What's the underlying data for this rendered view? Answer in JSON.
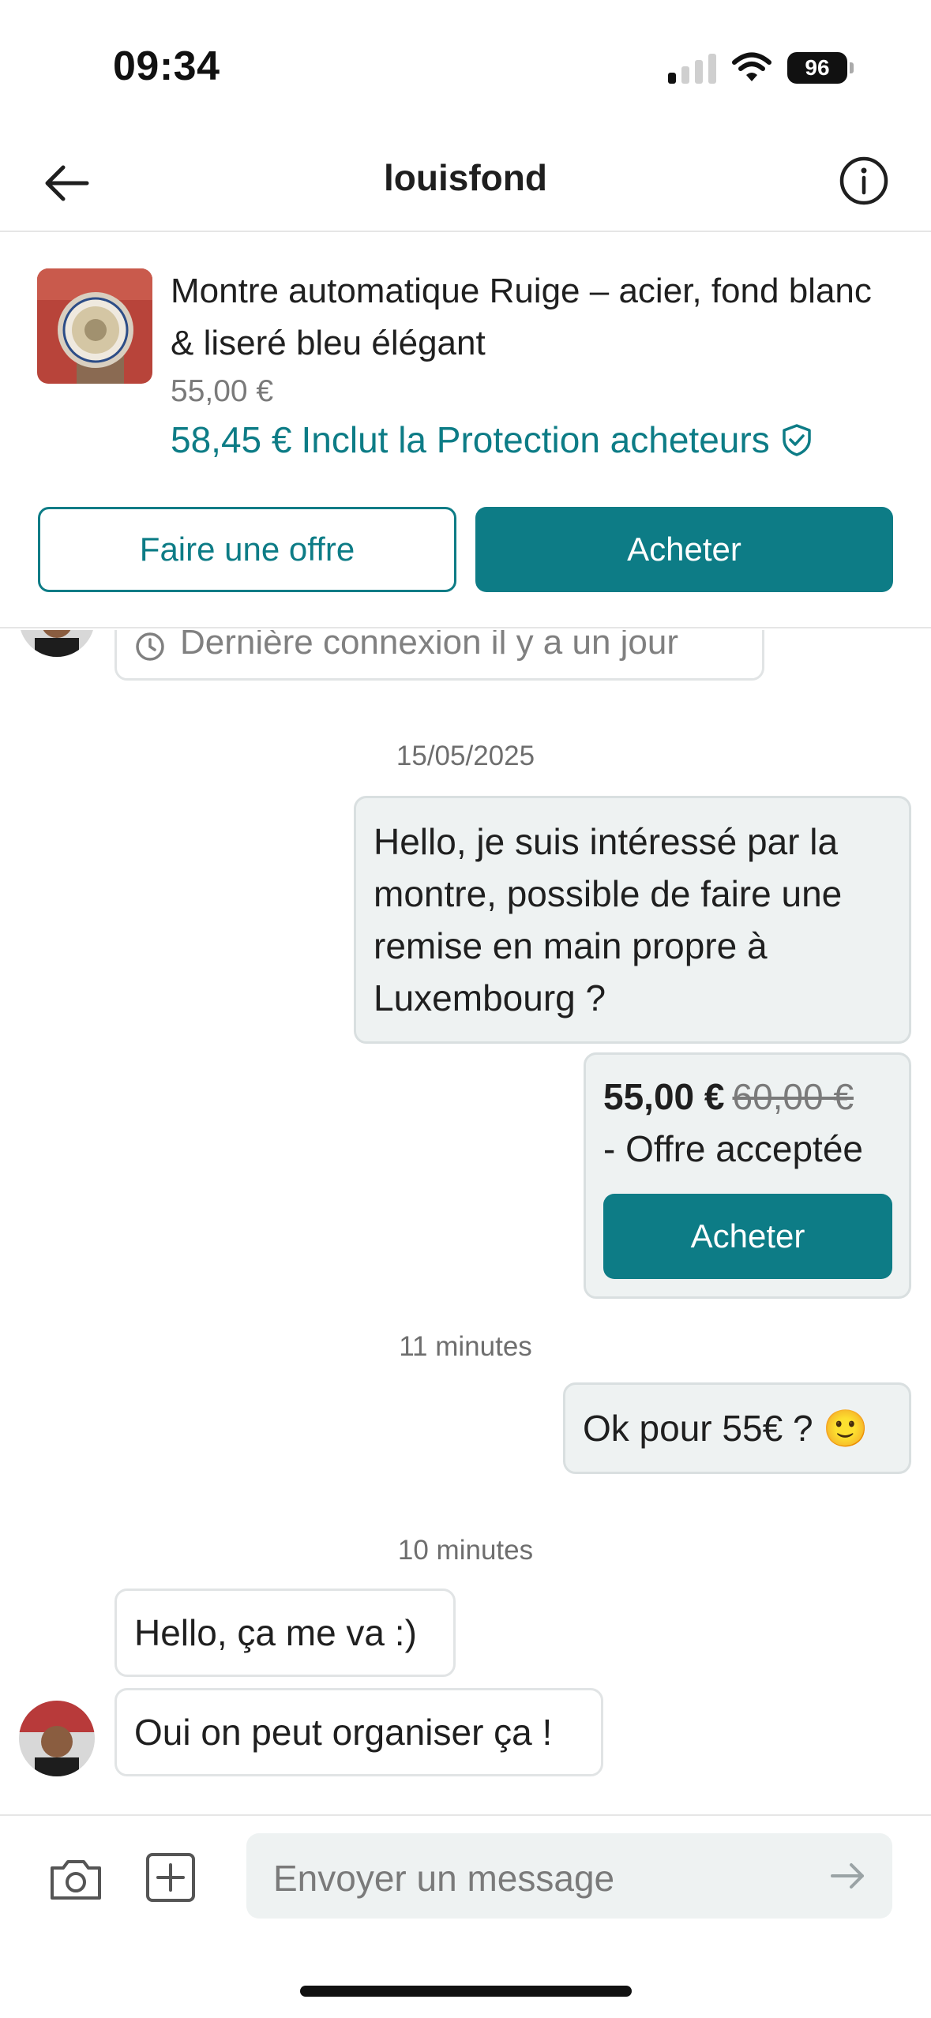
{
  "status_bar": {
    "time": "09:34",
    "battery": "96"
  },
  "header": {
    "title": "louisfond"
  },
  "item": {
    "title": "Montre automatique Ruige – acier, fond blanc & liseré bleu élégant",
    "price": "55,00 €",
    "protected_price": "58,45 €",
    "protection_label": "Inclut la Protection acheteurs",
    "offer_button": "Faire une offre",
    "buy_button": "Acheter"
  },
  "chat": {
    "last_seen": "Dernière connexion il y a un jour",
    "messages": [
      {
        "separator": "15/05/2025"
      },
      {
        "from": "me",
        "text": "Hello, je suis intéressé par la montre, possible de faire une remise en main propre à Luxembourg ?"
      },
      {
        "from": "me",
        "type": "offer",
        "price": "55,00 €",
        "old_price": "60,00 €",
        "status": "- Offre acceptée",
        "button": "Acheter"
      },
      {
        "separator": "11 minutes"
      },
      {
        "from": "me",
        "text": "Ok pour 55€ ? 🙂"
      },
      {
        "separator": "10 minutes"
      },
      {
        "from": "them",
        "text": "Hello, ça me va :)"
      },
      {
        "from": "them",
        "text": "Oui on peut organiser ça !"
      }
    ]
  },
  "composer": {
    "placeholder": "Envoyer un message"
  },
  "colors": {
    "accent": "#0d7c86",
    "bubble_mine": "#eef2f2"
  }
}
